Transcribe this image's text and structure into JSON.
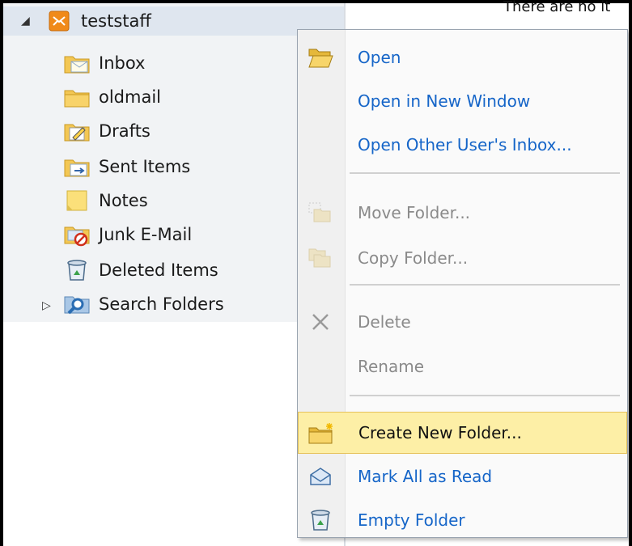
{
  "message_pane": {
    "text": "There are no it"
  },
  "folder_tree": {
    "root": {
      "label": "teststaff",
      "icon": "mailbox-icon"
    },
    "items": [
      {
        "label": "Inbox",
        "icon": "inbox-folder-icon"
      },
      {
        "label": "oldmail",
        "icon": "folder-icon"
      },
      {
        "label": "Drafts",
        "icon": "drafts-folder-icon"
      },
      {
        "label": "Sent Items",
        "icon": "sent-folder-icon"
      },
      {
        "label": "Notes",
        "icon": "notes-icon"
      },
      {
        "label": "Junk E-Mail",
        "icon": "junk-folder-icon"
      },
      {
        "label": "Deleted Items",
        "icon": "recycle-bin-icon"
      },
      {
        "label": "Search Folders",
        "icon": "search-folder-icon"
      }
    ]
  },
  "context_menu": {
    "items": [
      {
        "label": "Open",
        "state": "enabled",
        "icon": "open-folder-icon"
      },
      {
        "label": "Open in New Window",
        "state": "enabled",
        "icon": ""
      },
      {
        "label": "Open Other User's Inbox...",
        "state": "enabled",
        "icon": ""
      },
      {
        "label": "Move Folder...",
        "state": "disabled",
        "icon": "move-folder-icon"
      },
      {
        "label": "Copy Folder...",
        "state": "disabled",
        "icon": "copy-folder-icon"
      },
      {
        "label": "Delete",
        "state": "disabled",
        "icon": "delete-x-icon"
      },
      {
        "label": "Rename",
        "state": "disabled",
        "icon": ""
      },
      {
        "label": "Create New Folder...",
        "state": "hovered",
        "icon": "new-folder-icon"
      },
      {
        "label": "Mark All as Read",
        "state": "enabled",
        "icon": "mark-read-icon"
      },
      {
        "label": "Empty Folder",
        "state": "enabled",
        "icon": "recycle-bin-icon"
      }
    ]
  },
  "colors": {
    "menu_enabled_text": "#1565c8",
    "menu_disabled_text": "#8a8a8a",
    "menu_hover_bg": "#fdefa6",
    "tree_selected_bg": "#dfe6ef"
  }
}
